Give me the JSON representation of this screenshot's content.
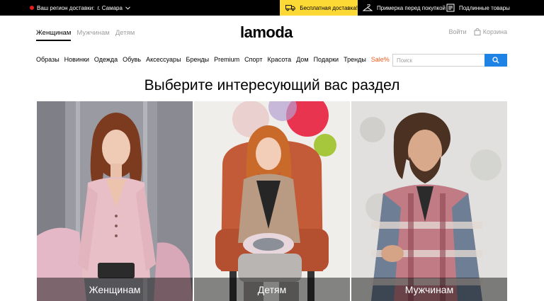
{
  "topbar": {
    "region_label": "Ваш регион доставки:",
    "region_city": "г. Самара",
    "promo_label": "Бесплатная доставка!",
    "perk_fitting": "Примерка перед покупкой",
    "perk_original": "Подлинные товары",
    "icons": [
      "location-dot",
      "chevron-down-icon",
      "truck-icon",
      "hanger-icon",
      "receipt-icon"
    ]
  },
  "header": {
    "gender_tabs": [
      "Женщинам",
      "Мужчинам",
      "Детям"
    ],
    "active_tab": "Женщинам",
    "logo": "lamoda",
    "login": "Войти",
    "cart": "Корзина"
  },
  "nav": {
    "items": [
      "Образы",
      "Новинки",
      "Одежда",
      "Обувь",
      "Аксессуары",
      "Бренды",
      "Premium",
      "Спорт",
      "Красота",
      "Дом",
      "Подарки",
      "Тренды",
      "Sale%"
    ]
  },
  "search": {
    "placeholder": "Поиск"
  },
  "main": {
    "headline": "Выберите интересующий вас раздел",
    "cards": [
      {
        "label": "Женщинам"
      },
      {
        "label": "Детям"
      },
      {
        "label": "Мужчинам"
      }
    ]
  },
  "colors": {
    "topbar_bg": "#000000",
    "promo_bg": "#fdd935",
    "accent_blue": "#1e83e4",
    "sale": "#f25a1d",
    "region_dot": "#e21e1e"
  }
}
